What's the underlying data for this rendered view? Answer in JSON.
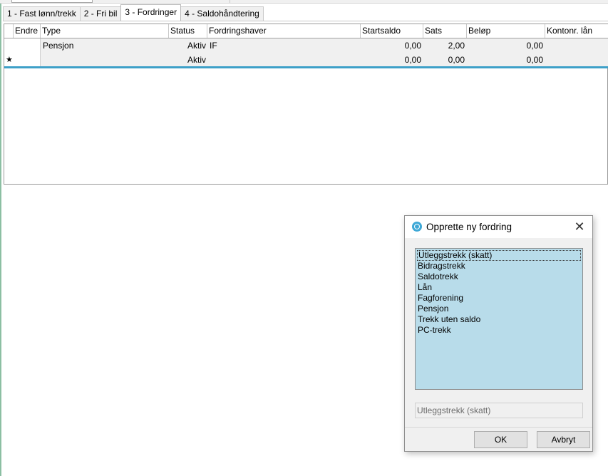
{
  "tabs": [
    {
      "label": "1 - Fast lønn/trekk"
    },
    {
      "label": "2 - Fri bil"
    },
    {
      "label": "3 - Fordringer",
      "active": true
    },
    {
      "label": "4 - Saldohåndtering"
    }
  ],
  "grid": {
    "columns": [
      "Endre",
      "Type",
      "Status",
      "Fordringshaver",
      "Startsaldo",
      "Sats",
      "Beløp",
      "Kontonr. lån"
    ],
    "rows": [
      {
        "marker": "",
        "endre": "",
        "type": "Pensjon",
        "status": "Aktiv",
        "fordringshaver": "IF",
        "startsaldo": "0,00",
        "sats": "2,00",
        "belop": "0,00",
        "kontonr": ""
      },
      {
        "marker": "★",
        "endre": "",
        "type": "",
        "status": "Aktiv",
        "fordringshaver": "",
        "startsaldo": "0,00",
        "sats": "0,00",
        "belop": "0,00",
        "kontonr": ""
      }
    ]
  },
  "dialog": {
    "title": "Opprette ny fordring",
    "close_glyph": "✕",
    "icon": "app-icon",
    "options": [
      "Utleggstrekk (skatt)",
      "Bidragstrekk",
      "Saldotrekk",
      "Lån",
      "Fagforening",
      "Pensjon",
      "Trekk uten saldo",
      "PC-trekk"
    ],
    "selected_option": "Utleggstrekk (skatt)",
    "selected_value": "Utleggstrekk (skatt)",
    "ok_label": "OK",
    "cancel_label": "Avbryt"
  },
  "colors": {
    "accent_line": "#3ea0c8",
    "listbox_bg": "#b8dcea"
  }
}
